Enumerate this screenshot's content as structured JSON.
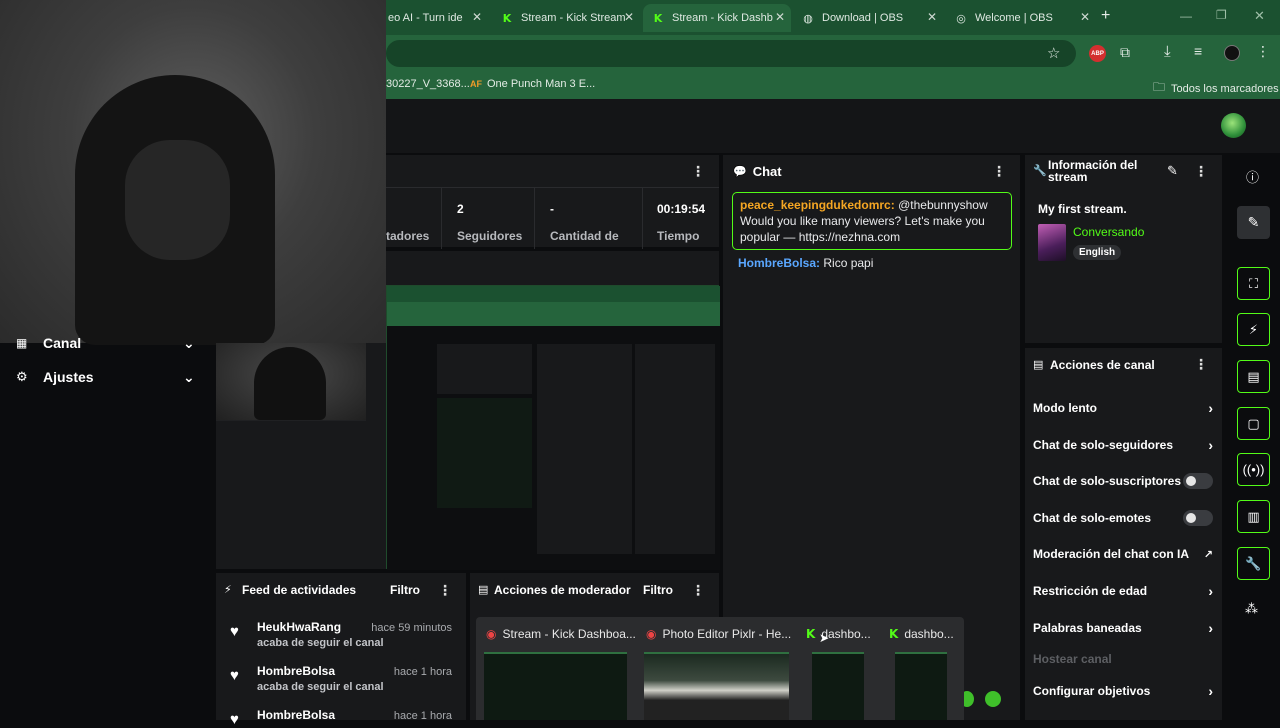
{
  "browser": {
    "tabs": [
      {
        "title": "eo AI - Turn ide",
        "icon": "generic-icon"
      },
      {
        "title": "Stream - Kick Stream",
        "icon": "kick-icon"
      },
      {
        "title": "Stream - Kick Dashb",
        "icon": "kick-icon",
        "active": true
      },
      {
        "title": "Download | OBS",
        "icon": "obs-icon"
      },
      {
        "title": "Welcome | OBS",
        "icon": "globe-icon"
      }
    ],
    "new_tab": "+",
    "bookmarks": [
      {
        "label": "30227_V_3368..."
      },
      {
        "label": "One Punch Man 3 E...",
        "prefix": "AF"
      }
    ],
    "all_bookmarks": "Todos los marcadores",
    "abp_badge": "ABP"
  },
  "stats": [
    {
      "value": "",
      "label": "tadores"
    },
    {
      "value": "2",
      "label": "Seguidores"
    },
    {
      "value": "-",
      "label": "Cantidad de"
    },
    {
      "value": "00:19:54",
      "label": "Tiempo"
    }
  ],
  "sidebar": {
    "items": [
      {
        "label": "Canal"
      },
      {
        "label": "Ajustes"
      }
    ]
  },
  "chat": {
    "title": "Chat",
    "messages": [
      {
        "user": "peace_keepingdukedomrc:",
        "text": "@thebunnyshow Would you like many viewers? Let's make you popular — https://nezhna.com",
        "user_color": "#f5a623"
      },
      {
        "user": "HombreBolsa:",
        "text": "Rico papi",
        "user_color": "#5aa7ff"
      }
    ]
  },
  "stream_info": {
    "title": "Información del stream",
    "stream_title": "My first stream.",
    "category": "Conversando",
    "language": "English"
  },
  "channel_actions": {
    "title": "Acciones de canal",
    "items": [
      {
        "label": "Modo lento",
        "control": "chevron"
      },
      {
        "label": "Chat de solo-seguidores",
        "control": "chevron"
      },
      {
        "label": "Chat de solo-suscriptores",
        "control": "toggle"
      },
      {
        "label": "Chat de solo-emotes",
        "control": "toggle"
      },
      {
        "label": "Moderación del chat con IA",
        "control": "external"
      },
      {
        "label": "Restricción de edad",
        "control": "chevron"
      },
      {
        "label": "Palabras baneadas",
        "control": "chevron"
      },
      {
        "label": "Hostear canal",
        "control": "none",
        "disabled": true
      },
      {
        "label": "Configurar objetivos",
        "control": "chevron"
      }
    ]
  },
  "activity_feed": {
    "title": "Feed de actividades",
    "filter": "Filtro",
    "items": [
      {
        "name": "HeukHwaRang",
        "action": "acaba de seguir el canal",
        "time": "hace 59 minutos"
      },
      {
        "name": "HombreBolsa",
        "action": "acaba de seguir el canal",
        "time": "hace 1 hora"
      },
      {
        "name": "HombreBolsa",
        "action": "",
        "time": "hace 1 hora"
      }
    ]
  },
  "mod_actions": {
    "title": "Acciones de moderador",
    "filter": "Filtro"
  },
  "taskbar_thumbs": [
    {
      "title": "Stream - Kick Dashboa...",
      "icon": "chrome-icon"
    },
    {
      "title": "Photo Editor Pixlr - He...",
      "icon": "chrome-icon"
    },
    {
      "title": "dashbo...",
      "icon": "kick-icon"
    },
    {
      "title": "dashbo...",
      "icon": "kick-icon"
    }
  ],
  "colors": {
    "accent": "#53fc18",
    "browser_frame": "#25643c",
    "panel": "#18191b",
    "background": "#0b0c0e"
  }
}
